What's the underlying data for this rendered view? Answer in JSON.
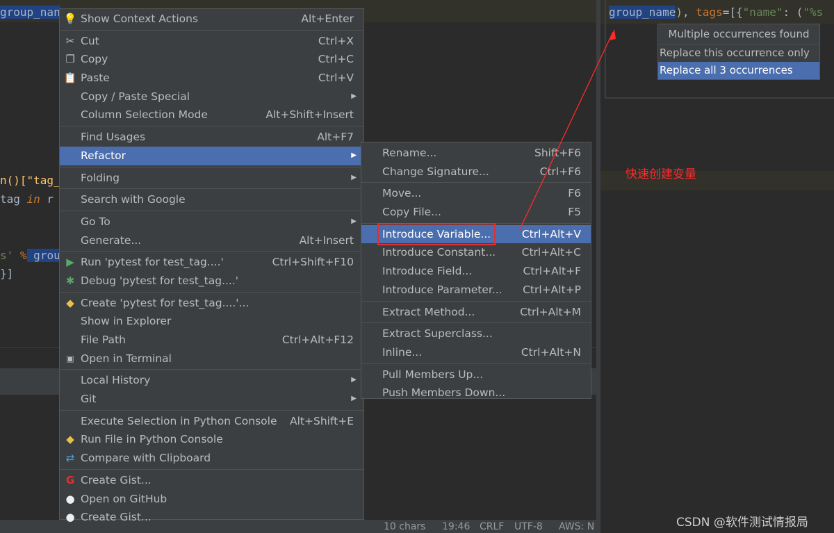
{
  "editor": {
    "line1": "group_nan",
    "line2a": "n()[\"tag_",
    "line3a": "tag ",
    "line3kw": "in",
    "line3b": " r",
    "line4a": "s' ",
    "line4pct": "%",
    "line4b": " grou",
    "line5": "}]"
  },
  "status": {
    "chars": "10 chars",
    "pos": "19:46",
    "crlf": "CRLF",
    "enc": "UTF-8",
    "aws": "AWS: N"
  },
  "right_code": {
    "sel": "group_name",
    "rest1": "), ",
    "kw": "tags",
    "rest2": "=[{",
    "str": "\"name\"",
    "rest3": ": (",
    "str2": "\"%s"
  },
  "occurrences": {
    "title": "Multiple occurrences found",
    "items": [
      "Replace this occurrence only",
      "Replace all 3 occurrences"
    ]
  },
  "annotation": "快速创建变量",
  "watermark": "CSDN @软件测试情报局",
  "context_menu": {
    "items": [
      {
        "label": "Show Context Actions",
        "shortcut": "Alt+Enter"
      },
      {
        "label": "Cut",
        "shortcut": "Ctrl+X"
      },
      {
        "label": "Copy",
        "shortcut": "Ctrl+C"
      },
      {
        "label": "Paste",
        "shortcut": "Ctrl+V"
      },
      {
        "label": "Copy / Paste Special",
        "shortcut": ""
      },
      {
        "label": "Column Selection Mode",
        "shortcut": "Alt+Shift+Insert"
      },
      {
        "label": "Find Usages",
        "shortcut": "Alt+F7"
      },
      {
        "label": "Refactor",
        "shortcut": ""
      },
      {
        "label": "Folding",
        "shortcut": ""
      },
      {
        "label": "Search with Google",
        "shortcut": ""
      },
      {
        "label": "Go To",
        "shortcut": ""
      },
      {
        "label": "Generate...",
        "shortcut": "Alt+Insert"
      },
      {
        "label": "Run 'pytest for test_tag....'",
        "shortcut": "Ctrl+Shift+F10"
      },
      {
        "label": "Debug 'pytest for test_tag....'",
        "shortcut": ""
      },
      {
        "label": "Create 'pytest for test_tag....'...",
        "shortcut": ""
      },
      {
        "label": "Show in Explorer",
        "shortcut": ""
      },
      {
        "label": "File Path",
        "shortcut": "Ctrl+Alt+F12"
      },
      {
        "label": "Open in Terminal",
        "shortcut": ""
      },
      {
        "label": "Local History",
        "shortcut": ""
      },
      {
        "label": "Git",
        "shortcut": ""
      },
      {
        "label": "Execute Selection in Python Console",
        "shortcut": "Alt+Shift+E"
      },
      {
        "label": "Run File in Python Console",
        "shortcut": ""
      },
      {
        "label": "Compare with Clipboard",
        "shortcut": ""
      },
      {
        "label": "Create Gist...",
        "shortcut": ""
      },
      {
        "label": "Open on GitHub",
        "shortcut": ""
      },
      {
        "label": "Create Gist...",
        "shortcut": ""
      }
    ]
  },
  "refactor_menu": {
    "items": [
      {
        "label": "Rename...",
        "shortcut": "Shift+F6"
      },
      {
        "label": "Change Signature...",
        "shortcut": "Ctrl+F6"
      },
      {
        "label": "Move...",
        "shortcut": "F6"
      },
      {
        "label": "Copy File...",
        "shortcut": "F5"
      },
      {
        "label": "Introduce Variable...",
        "shortcut": "Ctrl+Alt+V"
      },
      {
        "label": "Introduce Constant...",
        "shortcut": "Ctrl+Alt+C"
      },
      {
        "label": "Introduce Field...",
        "shortcut": "Ctrl+Alt+F"
      },
      {
        "label": "Introduce Parameter...",
        "shortcut": "Ctrl+Alt+P"
      },
      {
        "label": "Extract Method...",
        "shortcut": "Ctrl+Alt+M"
      },
      {
        "label": "Extract Superclass...",
        "shortcut": ""
      },
      {
        "label": "Inline...",
        "shortcut": "Ctrl+Alt+N"
      },
      {
        "label": "Pull Members Up...",
        "shortcut": ""
      },
      {
        "label": "Push Members Down...",
        "shortcut": ""
      }
    ]
  },
  "colors": {
    "highlight": "#4b6eaf",
    "menu_bg": "#3c3f41",
    "annotation": "#ff2a2a"
  }
}
